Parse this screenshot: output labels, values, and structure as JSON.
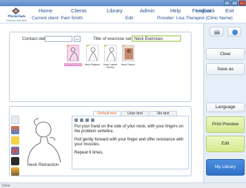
{
  "nav": {
    "logo_text": "PhysioTools",
    "logo_tagline": "Printouts that Work",
    "items": [
      "Home",
      "Clients",
      "Library",
      "Admin",
      "Help",
      "Feedback",
      "Logout",
      "Exit"
    ]
  },
  "info": {
    "client": "Current client: Pam Smith",
    "edit": "Edit",
    "provider": "Provider: Lisa Therapist (Clinic Name)"
  },
  "top_panel": {
    "contact_date_label": "Contact date",
    "contact_date_value": "",
    "date_button": "...",
    "title_label": "Title of exercise set",
    "title_value": "Neck Exercises",
    "thumbs": [
      {
        "caption": "Neck Retraction"
      },
      {
        "caption": "Neck Rotation"
      },
      {
        "caption": "Neck Lateral Flexion"
      },
      {
        "caption": "Neck Flexion"
      }
    ]
  },
  "right": {
    "clear": "Clear",
    "save_as": "Save as",
    "language": "Language",
    "print_preview": "Print Preview",
    "edit": "Edit",
    "my_library": "My Library"
  },
  "bottom_panel": {
    "image_caption": "Neck Retraction",
    "tabs": [
      "Default text",
      "User text",
      "No text"
    ],
    "paragraphs": [
      "Put your hand on the side of your neck, with your fingers on the problem vertebra.",
      "Pull gently forward with your finger and offer resistance with your muscles.",
      "Repeat 6 times."
    ]
  },
  "status": {
    "text": "Done"
  },
  "colors": {
    "brand": "#1f4f8f",
    "accent_tab": "#d9541e",
    "selected_thumb": "#e277c4",
    "green_button": "#d4ea8c",
    "blue_button": "#2f6fc7"
  }
}
